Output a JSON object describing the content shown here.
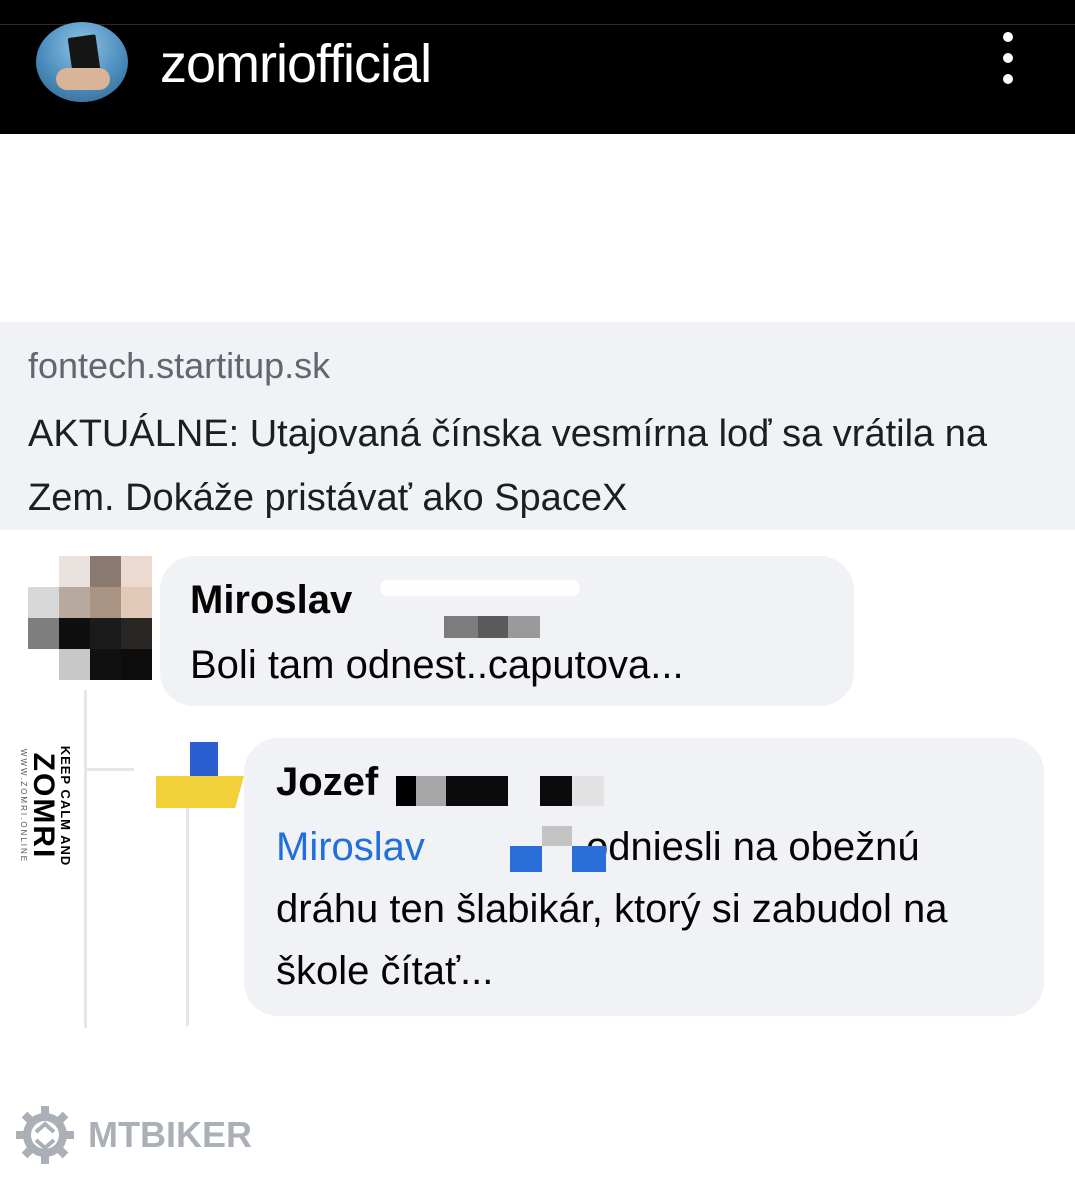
{
  "header": {
    "username": "zomriofficial",
    "avatar_icon": "profile-photo",
    "more_icon": "three-dots-vertical-icon"
  },
  "link_preview": {
    "domain": "fontech.startitup.sk",
    "title": "AKTUÁLNE: Utajovaná čínska vesmírna loď sa vrátila na Zem. Dokáže pristávať ako SpaceX"
  },
  "comments": [
    {
      "author": "Miroslav",
      "text": "Boli tam odnest..caputova...",
      "avatar": "pixelated-avatar"
    },
    {
      "author": "Jozef",
      "mention": "Miroslav",
      "text": " odniesli na obežnú dráhu ten šlabikár, ktorý si zabudol na škole čítať...",
      "avatar": "ukraine-flag-avatar"
    }
  ],
  "watermarks": {
    "zomri_top": "KEEP CALM AND",
    "zomri_main": "ZOMRI",
    "zomri_url": "WWW.ZOMRI.ONLINE",
    "mtbiker": "MTBIKER"
  },
  "colors": {
    "header_bg": "#000000",
    "bubble_bg": "#f0f2f5",
    "mention": "#216fdb",
    "mtbiker_gray": "#aab0b6"
  }
}
